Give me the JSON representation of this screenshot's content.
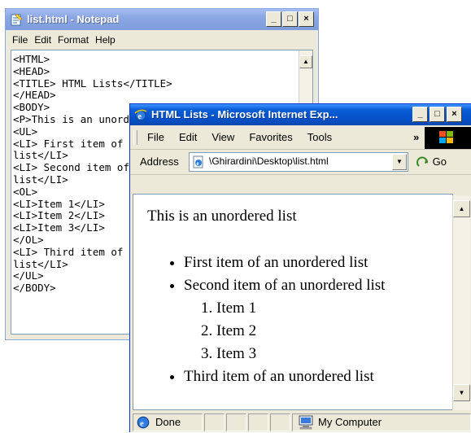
{
  "notepad": {
    "title": "list.html - Notepad",
    "menu": [
      "File",
      "Edit",
      "Format",
      "Help"
    ],
    "content": "<HTML>\n<HEAD>\n<TITLE> HTML Lists</TITLE>\n</HEAD>\n<BODY>\n<P>This is an unordered list\n<UL>\n<LI> First item of an unordered\nlist</LI>\n<LI> Second item of an unordered\nlist</LI>\n<OL>\n<LI>Item 1</LI>\n<LI>Item 2</LI>\n<LI>Item 3</LI>\n</OL>\n<LI> Third item of an unordered\nlist</LI>\n</UL>\n</BODY>"
  },
  "ie": {
    "title": "HTML Lists - Microsoft Internet Exp...",
    "menu": [
      "File",
      "Edit",
      "View",
      "Favorites",
      "Tools"
    ],
    "chevron": "»",
    "address_label": "Address",
    "address_value": "\\Ghirardini\\Desktop\\list.html",
    "go_label": "Go",
    "page": {
      "paragraph": "This is an unordered list",
      "items": [
        "First item of an unordered list",
        "Second item of an unordered list",
        "Third item of an unordered list"
      ],
      "ordered_items": [
        "Item 1",
        "Item 2",
        "Item 3"
      ]
    },
    "status_text": "Done",
    "status_zone": "My Computer"
  },
  "colors": {
    "titlebar_active": "#0a5fd8",
    "titlebar_inactive": "#8aa6e3",
    "window_face": "#ece9d8"
  },
  "icons": [
    "notepad-icon",
    "ie-icon",
    "page-icon",
    "go-arrow-icon",
    "done-icon",
    "my-computer-icon",
    "windows-logo"
  ]
}
